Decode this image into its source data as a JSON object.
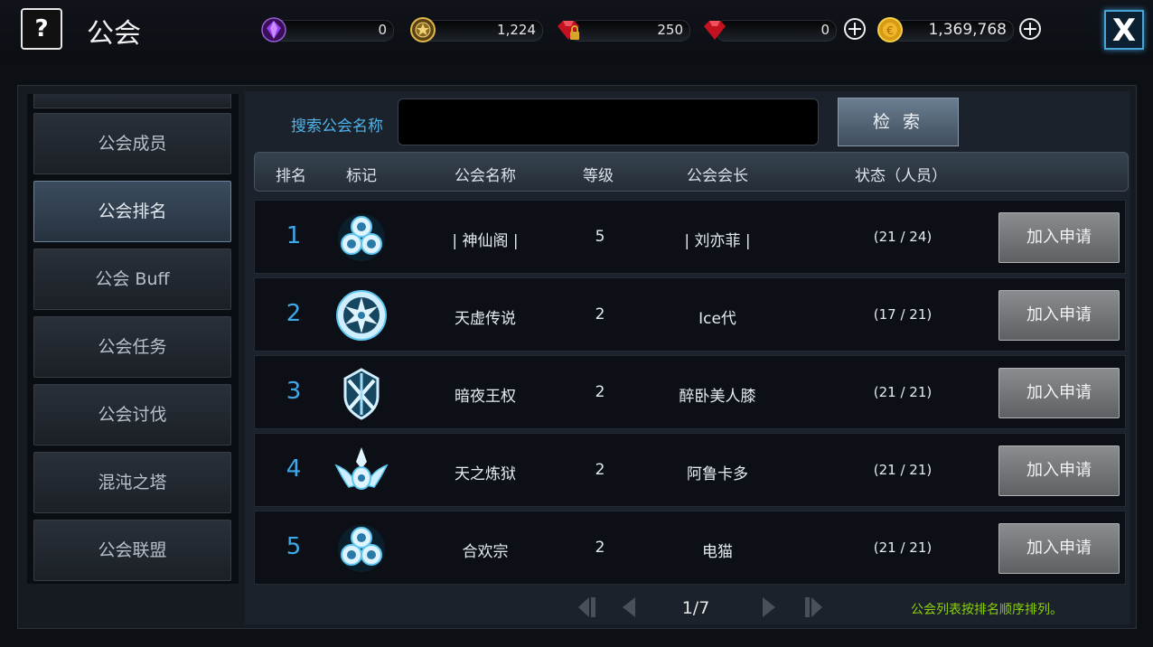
{
  "header": {
    "help_label": "?",
    "title": "公会",
    "close_label": "X",
    "currencies": [
      {
        "name": "purple-gem",
        "value": "0",
        "color": "#8a2be2"
      },
      {
        "name": "guild-coin",
        "value": "1,224",
        "color": "#c9a23a"
      },
      {
        "name": "locked-ruby",
        "value": "250",
        "color": "#d11a2a"
      },
      {
        "name": "ruby",
        "value": "0",
        "color": "#d11a2a"
      },
      {
        "name": "gold-coin",
        "value": "1,369,768",
        "color": "#e8b320"
      }
    ]
  },
  "sidebar": {
    "items": [
      {
        "label": "公会成员",
        "active": false
      },
      {
        "label": "公会排名",
        "active": true
      },
      {
        "label": "公会 Buff",
        "active": false
      },
      {
        "label": "公会任务",
        "active": false
      },
      {
        "label": "公会讨伐",
        "active": false
      },
      {
        "label": "混沌之塔",
        "active": false
      },
      {
        "label": "公会联盟",
        "active": false
      }
    ]
  },
  "search": {
    "label": "搜索公会名称",
    "value": "",
    "button_label": "检 索"
  },
  "table": {
    "headers": [
      "排名",
      "标记",
      "公会名称",
      "等级",
      "公会会长",
      "状态（人员）"
    ],
    "rows": [
      {
        "rank": "1",
        "emblem": "triskelion-emblem",
        "name": "| 神仙阁 |",
        "level": "5",
        "leader": "| 刘亦菲 |",
        "status": "(21 / 24)",
        "action": "加入申请"
      },
      {
        "rank": "2",
        "emblem": "dragon-emblem",
        "name": "天虚传说",
        "level": "2",
        "leader": "Ice代",
        "status": "(17 / 21)",
        "action": "加入申请"
      },
      {
        "rank": "3",
        "emblem": "crossed-swords-emblem",
        "name": "暗夜王权",
        "level": "2",
        "leader": "醉卧美人膝",
        "status": "(21 / 21)",
        "action": "加入申请"
      },
      {
        "rank": "4",
        "emblem": "winged-eye-emblem",
        "name": "天之炼狱",
        "level": "2",
        "leader": "阿鲁卡多",
        "status": "(21 / 21)",
        "action": "加入申请"
      },
      {
        "rank": "5",
        "emblem": "triskelion-emblem",
        "name": "合欢宗",
        "level": "2",
        "leader": "电猫",
        "status": "(21 / 21)",
        "action": "加入申请"
      }
    ]
  },
  "pagination": {
    "page": "1/7"
  },
  "hint": "公会列表按排名顺序排列。"
}
